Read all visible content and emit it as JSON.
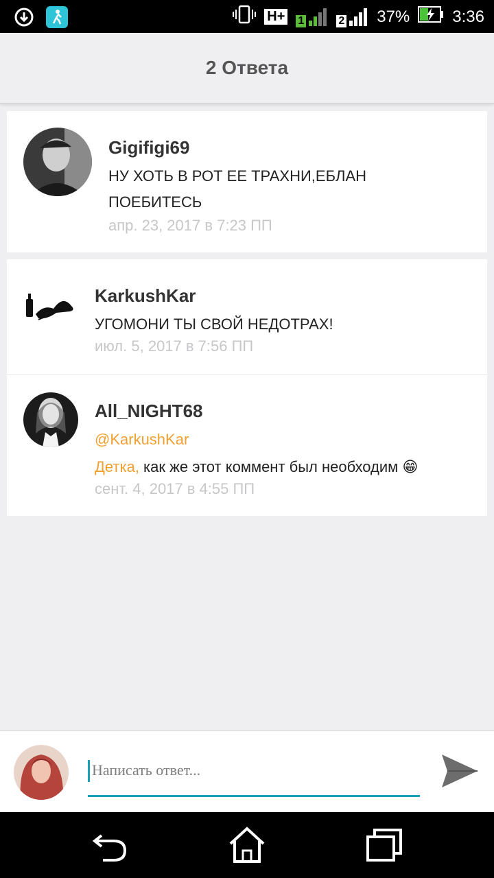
{
  "status_bar": {
    "network": "H+",
    "sim1": "1",
    "sim2": "2",
    "battery": "37%",
    "time": "3:36"
  },
  "header": {
    "title": "2 Ответа"
  },
  "comments": [
    {
      "username": "Gigifigi69",
      "text_line1": "НУ ХОТЬ В РОТ ЕЕ ТРАХНИ,ЕБЛАН",
      "text_line2": "ПОЕБИТЕСЬ",
      "date": "апр. 23, 2017 в 7:23 ПП"
    },
    {
      "username": "KarkushKar",
      "text": "УГОМОНИ ТЫ СВОЙ НЕДОТРАХ!",
      "date": "июл. 5, 2017 в 7:56 ПП"
    },
    {
      "username": "All_NIGHT68",
      "mention": "@KarkushKar",
      "text_highlight": "Детка,",
      "text": " как же этот коммент был необходим 😁",
      "date": "сент. 4, 2017 в 4:55 ПП"
    }
  ],
  "composer": {
    "placeholder": "Написать ответ..."
  },
  "icons": {
    "accent": "#17a3b3",
    "mention_color": "#f0a030"
  }
}
